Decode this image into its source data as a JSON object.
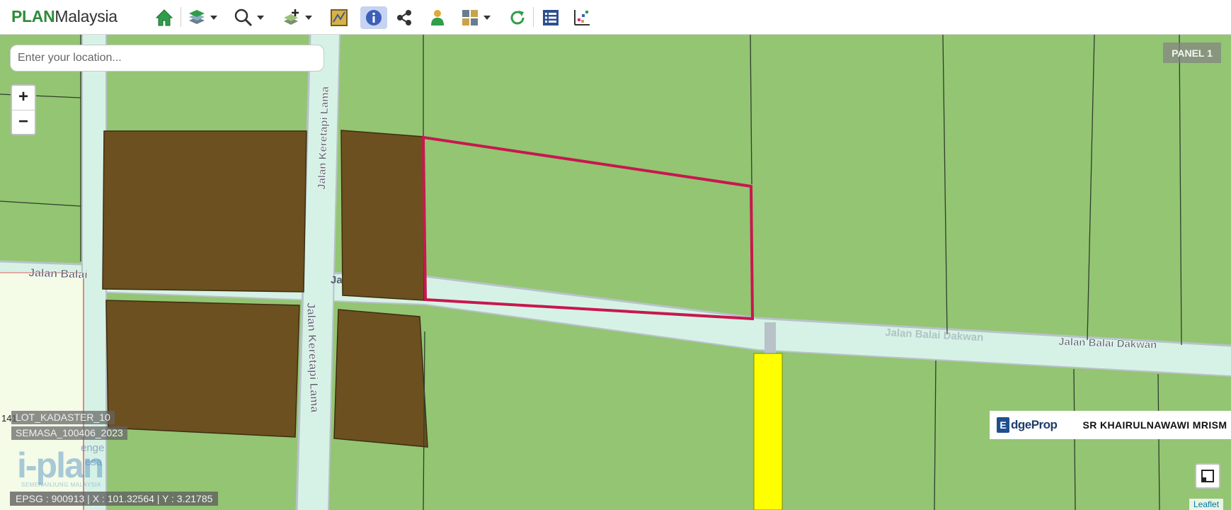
{
  "app": {
    "logo_plan": "PLAN",
    "logo_malaysia": "Malaysia"
  },
  "toolbar": {
    "tools": [
      {
        "icon": "home-icon"
      },
      {
        "icon": "layers-icon",
        "dropdown": true
      },
      {
        "icon": "zoom-icon",
        "dropdown": true
      },
      {
        "icon": "add-layer-icon",
        "dropdown": true
      },
      {
        "icon": "map-sheet-icon"
      },
      {
        "icon": "info-icon",
        "active": true
      },
      {
        "icon": "share-icon"
      },
      {
        "icon": "person-icon"
      },
      {
        "icon": "grid-icon",
        "dropdown": true
      },
      {
        "icon": "refresh-icon"
      },
      {
        "icon": "list-icon"
      },
      {
        "icon": "chart-icon"
      }
    ],
    "active_color": "#c6d3f2"
  },
  "search": {
    "placeholder": "Enter your location...",
    "value": ""
  },
  "zoom": {
    "in_label": "+",
    "out_label": "−"
  },
  "panel": {
    "label": "PANEL 1"
  },
  "streets": {
    "balai_west": "Jalan Balai",
    "keretapi_north": "Jalan Keretapi Lama",
    "keretapi_south": "Jalan Keretapi Lama",
    "ja_fragment": "Ja",
    "dakwan_faded": "Jalan Balai Dakwan",
    "dakwan_east": "Jalan Balai Dakwan"
  },
  "layers": {
    "cadastre": "LOT_KADASTER_10",
    "semasa": "SEMASA_100406_2023"
  },
  "ghost_text": {
    "line1": "enge",
    "line2": "esa"
  },
  "lot_number": "141",
  "iplan": {
    "logo": "i-plan",
    "tagline": "SEMENANJUNG MALAYSIA"
  },
  "coords": {
    "text": "EPSG : 900913 | X : 101.32564 | Y : 3.21785"
  },
  "watermark": {
    "brand_e": "E",
    "brand_rest": "dgeProp",
    "author": "SR KHAIRULNAWAWI MRISM"
  },
  "attribution": "Leaflet",
  "colors": {
    "agriculture": "#93c573",
    "brown_lot": "#6d5020",
    "road": "#d6f2e6",
    "road_edge": "#b8c2c8",
    "highlight": "#c8174e",
    "yellow_strip": "#ffff00",
    "pale_lot": "#f4fbe6"
  }
}
